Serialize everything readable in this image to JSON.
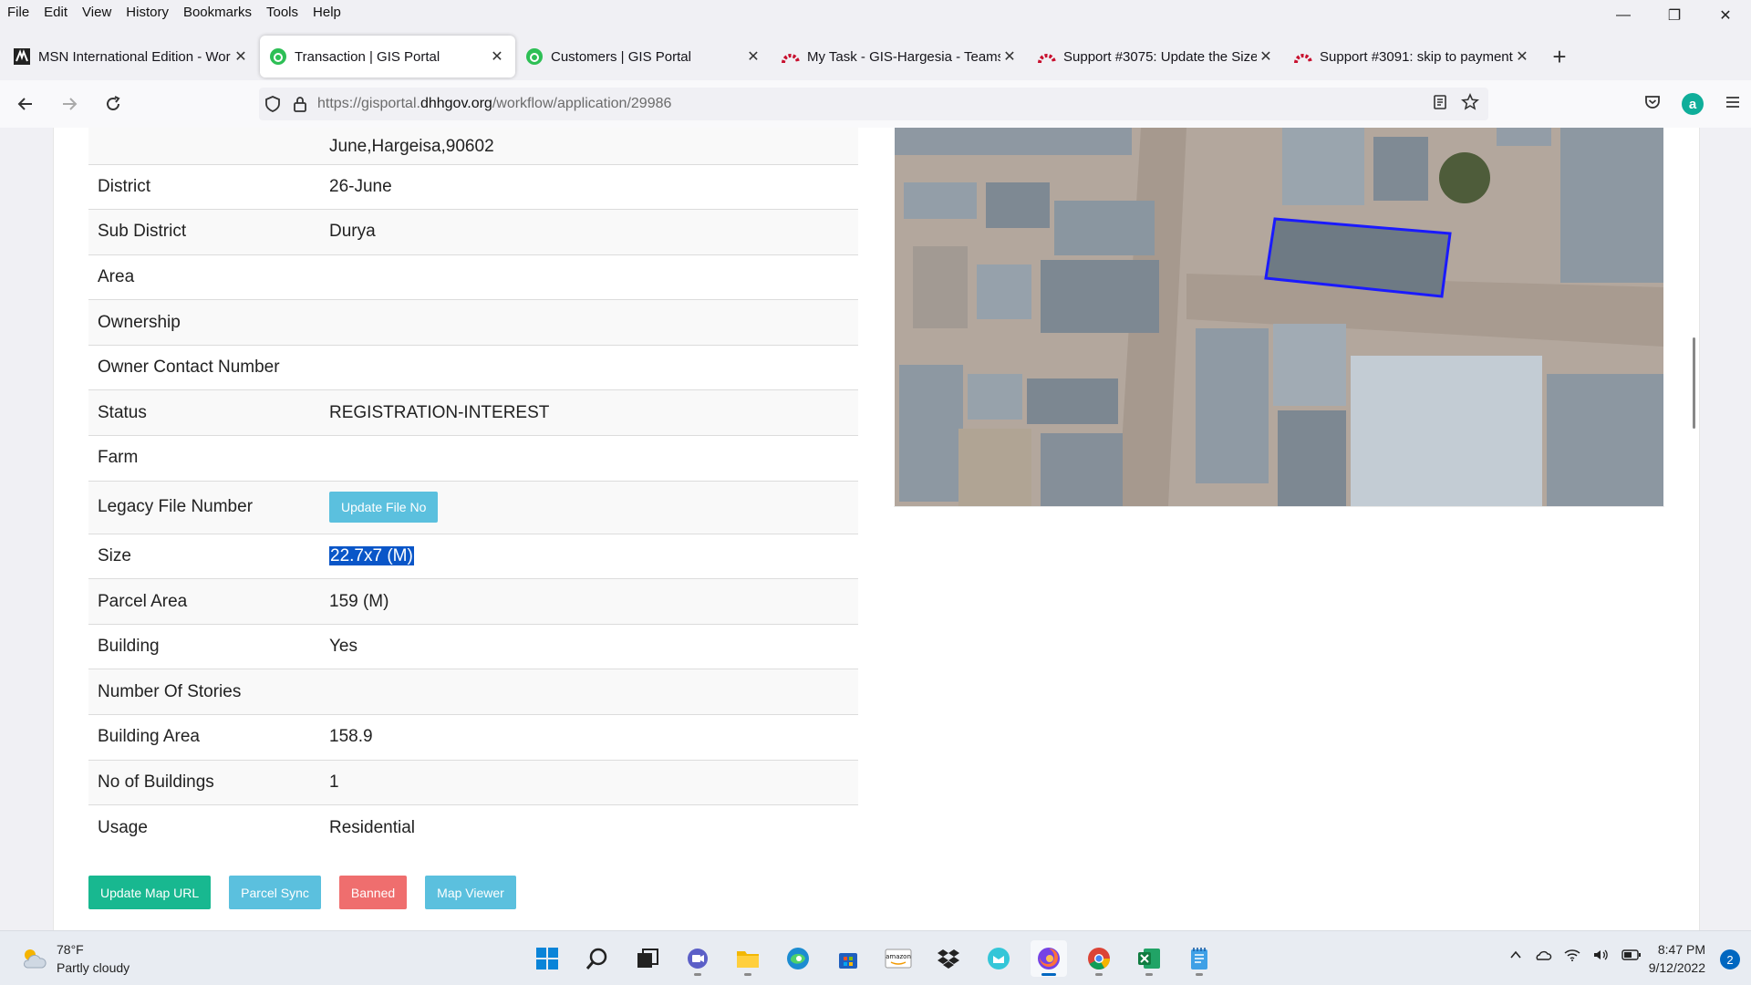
{
  "menu": {
    "items": [
      "File",
      "Edit",
      "View",
      "History",
      "Bookmarks",
      "Tools",
      "Help"
    ]
  },
  "window": {
    "minimize_glyph": "—",
    "restore_glyph": "❐",
    "close_glyph": "✕"
  },
  "tabs": [
    {
      "label": "MSN International Edition - Wor",
      "icon": "msn-icon",
      "active": false
    },
    {
      "label": "Transaction | GIS Portal",
      "icon": "gis-portal-icon",
      "active": true
    },
    {
      "label": "Customers | GIS Portal",
      "icon": "gis-portal-icon",
      "active": false
    },
    {
      "label": "My Task - GIS-Hargesia - Teams",
      "icon": "redmine-icon",
      "active": false
    },
    {
      "label": "Support #3075: Update the Size",
      "icon": "redmine-icon",
      "active": false
    },
    {
      "label": "Support #3091: skip to payment",
      "icon": "redmine-icon",
      "active": false
    }
  ],
  "address": {
    "prefix": "https://gisportal.",
    "domain": "dhhgov.org",
    "path": "/workflow/application/29986"
  },
  "details": {
    "address_tail": "June,Hargeisa,90602",
    "rows": [
      {
        "key": "District",
        "value": "26-June"
      },
      {
        "key": "Sub District",
        "value": "Durya"
      },
      {
        "key": "Area",
        "value": ""
      },
      {
        "key": "Ownership",
        "value": ""
      },
      {
        "key": "Owner Contact Number",
        "value": ""
      },
      {
        "key": "Status",
        "value": "REGISTRATION-INTEREST"
      },
      {
        "key": "Farm",
        "value": ""
      },
      {
        "key": "Legacy File Number",
        "button": "Update File No"
      },
      {
        "key": "Size",
        "value": "22.7x7 (M)",
        "selected": true
      },
      {
        "key": "Parcel Area",
        "value": "159 (M)"
      },
      {
        "key": "Building",
        "value": "Yes"
      },
      {
        "key": "Number Of Stories",
        "value": ""
      },
      {
        "key": "Building Area",
        "value": "158.9"
      },
      {
        "key": "No of Buildings",
        "value": "1"
      },
      {
        "key": "Usage",
        "value": "Residential"
      }
    ]
  },
  "actions": {
    "update_map_url": "Update Map URL",
    "parcel_sync": "Parcel Sync",
    "banned": "Banned",
    "map_viewer": "Map Viewer"
  },
  "map": {
    "parcel_outline_color": "#1a1aff"
  },
  "taskbar": {
    "temperature": "78°F",
    "condition": "Partly cloudy",
    "time": "8:47 PM",
    "date": "9/12/2022",
    "notification_count": "2",
    "apps": [
      "start-icon",
      "search-icon",
      "task-view-icon",
      "teams-chat-icon",
      "file-explorer-icon",
      "edge-icon",
      "store-icon",
      "amazon-icon",
      "dropbox-icon",
      "chat-app-icon",
      "firefox-icon",
      "chrome-icon",
      "excel-icon",
      "notepad-icon"
    ]
  },
  "colors": {
    "accent_green": "#18b890",
    "accent_cyan": "#5bc0de",
    "accent_red": "#ef6e6e",
    "selection": "#0a56c8"
  }
}
